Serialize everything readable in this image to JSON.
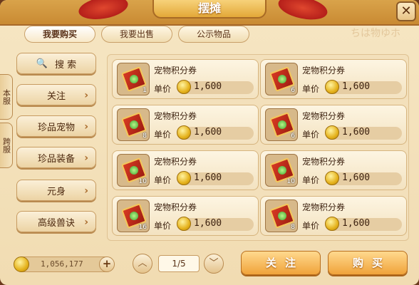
{
  "window": {
    "title": "摆摊",
    "close_symbol": "✕",
    "watermark": "ちは物ゆホ"
  },
  "tabs": [
    {
      "label": "我要购买",
      "active": true
    },
    {
      "label": "我要出售",
      "active": false
    },
    {
      "label": "公示物品",
      "active": false
    }
  ],
  "side_tabs": [
    {
      "label": "本服"
    },
    {
      "label": "跨服"
    }
  ],
  "sidebar": {
    "search_label": "搜 索",
    "items": [
      {
        "label": "关注"
      },
      {
        "label": "珍品宠物"
      },
      {
        "label": "珍品装备"
      },
      {
        "label": "元身"
      },
      {
        "label": "高级兽诀"
      }
    ]
  },
  "listings": [
    {
      "name": "宠物积分券",
      "price_label": "单价",
      "price": "1,600",
      "qty": "1"
    },
    {
      "name": "宠物积分券",
      "price_label": "单价",
      "price": "1,600",
      "qty": "6"
    },
    {
      "name": "宠物积分券",
      "price_label": "单价",
      "price": "1,600",
      "qty": "8"
    },
    {
      "name": "宠物积分券",
      "price_label": "单价",
      "price": "1,600",
      "qty": "6"
    },
    {
      "name": "宠物积分券",
      "price_label": "单价",
      "price": "1,600",
      "qty": "10"
    },
    {
      "name": "宠物积分券",
      "price_label": "单价",
      "price": "1,600",
      "qty": "10"
    },
    {
      "name": "宠物积分券",
      "price_label": "单价",
      "price": "1,600",
      "qty": "16"
    },
    {
      "name": "宠物积分券",
      "price_label": "单价",
      "price": "1,600",
      "qty": "8"
    }
  ],
  "footer": {
    "currency": "1,056,177",
    "plus_symbol": "+",
    "page": "1/5",
    "up_symbol": "︿",
    "down_symbol": "﹀",
    "follow_label": "关注",
    "buy_label": "购买"
  },
  "colors": {
    "accent": "#f0a33a",
    "frame": "#f6e6c3",
    "header": "#d9a34a"
  }
}
